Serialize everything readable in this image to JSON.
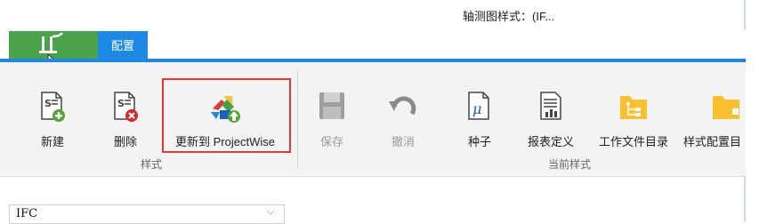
{
  "window": {
    "title": "轴测图样式：(IF..."
  },
  "tabs": [
    {
      "label": "配置"
    }
  ],
  "ribbon": {
    "groups": [
      {
        "label": "样式",
        "buttons": [
          {
            "label": "新建",
            "icon": "new-document-icon"
          },
          {
            "label": "删除",
            "icon": "delete-document-icon"
          },
          {
            "label": "更新到 ProjectWise",
            "icon": "update-projectwise-icon"
          }
        ]
      },
      {
        "label": "当前样式",
        "buttons": [
          {
            "label": "保存",
            "icon": "save-icon",
            "disabled": true
          },
          {
            "label": "撤消",
            "icon": "undo-icon",
            "disabled": true
          },
          {
            "label": "种子",
            "icon": "seed-icon"
          },
          {
            "label": "报表定义",
            "icon": "report-icon"
          },
          {
            "label": "工作文件目录",
            "icon": "folder-tree-icon"
          },
          {
            "label": "样式配置目",
            "icon": "folder-icon"
          }
        ]
      }
    ]
  },
  "combo": {
    "value": "IFC"
  },
  "colors": {
    "accent": "#1e88e5",
    "home": "#4aa34a",
    "highlight": "#e53935"
  }
}
